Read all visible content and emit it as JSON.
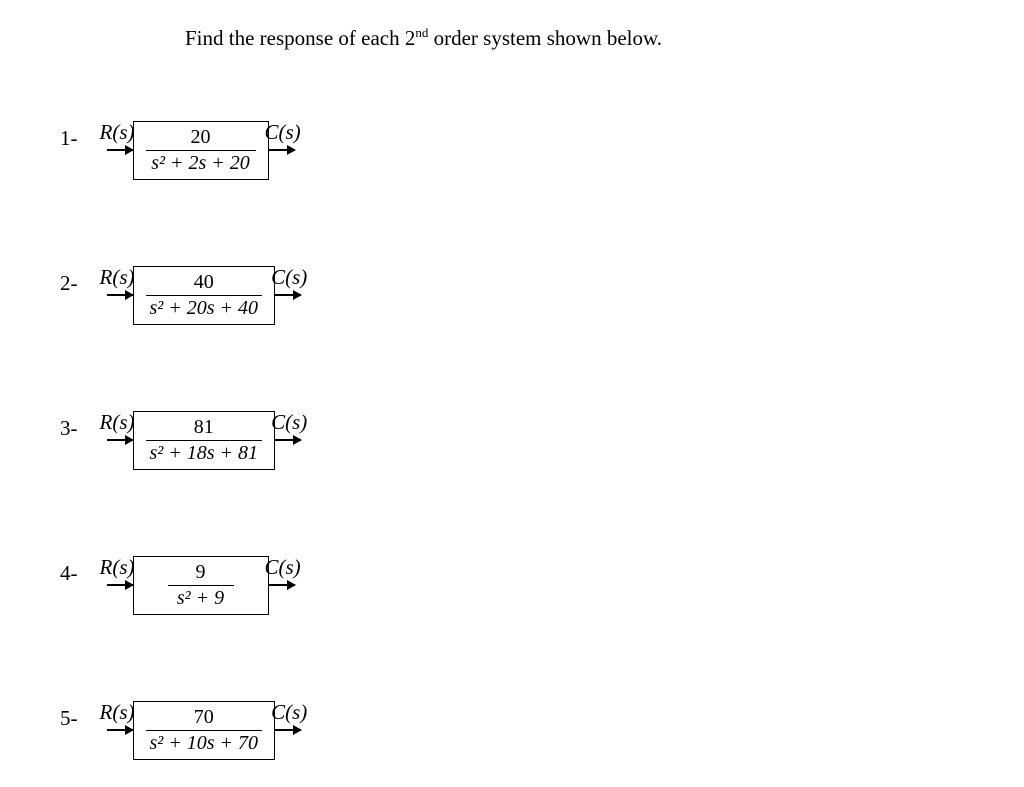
{
  "title_pre": "Find the response of each 2",
  "title_sup": "nd",
  "title_post": " order system shown below.",
  "input_label": "R(s)",
  "output_label": "C(s)",
  "systems": [
    {
      "label": "1-",
      "numerator": "20",
      "denominator": "s² + 2s + 20"
    },
    {
      "label": "2-",
      "numerator": "40",
      "denominator": "s² + 20s + 40"
    },
    {
      "label": "3-",
      "numerator": "81",
      "denominator": "s² + 18s + 81"
    },
    {
      "label": "4-",
      "numerator": "9",
      "denominator": "s² + 9"
    },
    {
      "label": "5-",
      "numerator": "70",
      "denominator": "s² + 10s + 70"
    }
  ]
}
